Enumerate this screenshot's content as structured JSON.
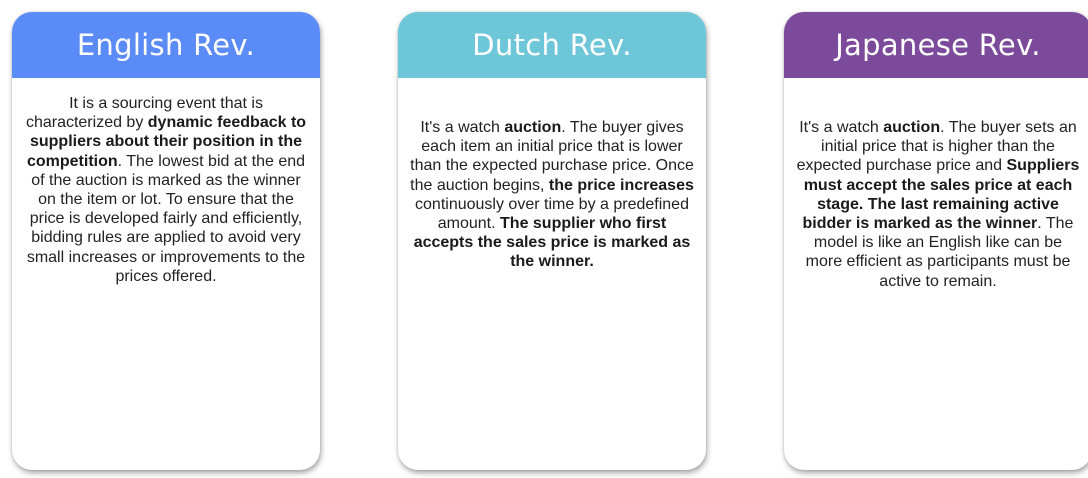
{
  "colors": {
    "english_header": "#5b8bf7",
    "dutch_header": "#6ec6d9",
    "japanese_header": "#7c4a9a"
  },
  "cards": [
    {
      "title": "English Rev.",
      "segments": [
        {
          "text": "It is a sourcing event that is characterized by ",
          "bold": false
        },
        {
          "text": "dynamic feedback to suppliers about their position in the competition",
          "bold": true
        },
        {
          "text": ". The lowest bid at the end of the auction is marked as the winner on the item or lot. To ensure that the price is developed fairly and efficiently, bidding rules are applied to avoid very small increases or improvements to the prices offered.",
          "bold": false
        }
      ]
    },
    {
      "title": "Dutch Rev.",
      "segments": [
        {
          "text": "It's a watch ",
          "bold": false
        },
        {
          "text": "auction",
          "bold": true
        },
        {
          "text": ". The buyer gives each item an initial price that is lower than the expected purchase price. Once the auction begins, ",
          "bold": false
        },
        {
          "text": "the price increases",
          "bold": true
        },
        {
          "text": " continuously over time by a predefined amount. ",
          "bold": false
        },
        {
          "text": "The supplier who first accepts the sales price is marked as the winner.",
          "bold": true
        }
      ]
    },
    {
      "title": "Japanese Rev.",
      "segments": [
        {
          "text": "It's a watch ",
          "bold": false
        },
        {
          "text": "auction",
          "bold": true
        },
        {
          "text": ". The buyer sets an initial price that is higher than the expected purchase price and ",
          "bold": false
        },
        {
          "text": "Suppliers must accept the sales price at each stage. The last remaining active bidder is marked as the winner",
          "bold": true
        },
        {
          "text": ". The model is like an English like can be more efficient as participants must be active to remain.",
          "bold": false
        }
      ]
    }
  ]
}
